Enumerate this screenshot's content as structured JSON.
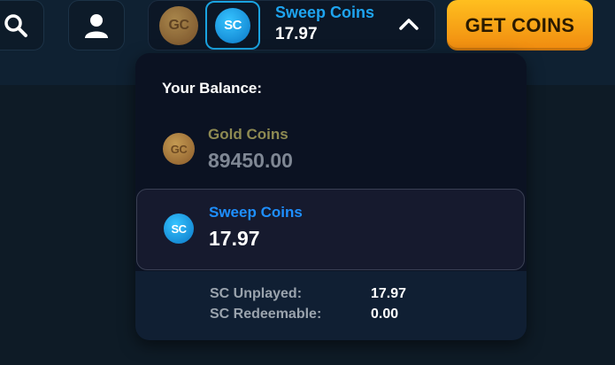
{
  "topbar": {
    "search_icon": "search-icon",
    "profile_icon": "user-icon"
  },
  "balance_pill": {
    "gc_coin_text": "GC",
    "sc_coin_text": "SC",
    "selected_label": "Sweep Coins",
    "selected_value": "17.97",
    "chevron_icon": "chevron-up-icon"
  },
  "get_coins_label": "GET COINS",
  "dropdown": {
    "title": "Your Balance:",
    "gold": {
      "coin_text": "GC",
      "label": "Gold Coins",
      "value": "89450.00"
    },
    "sweep": {
      "coin_text": "SC",
      "label": "Sweep Coins",
      "value": "17.97"
    },
    "details": [
      {
        "label": "SC Unplayed:",
        "value": "17.97"
      },
      {
        "label": "SC Redeemable:",
        "value": "0.00"
      }
    ]
  },
  "colors": {
    "accent_blue": "#1ea4ef",
    "button_orange": "#f5a216",
    "gold_text": "#8e8a52"
  }
}
